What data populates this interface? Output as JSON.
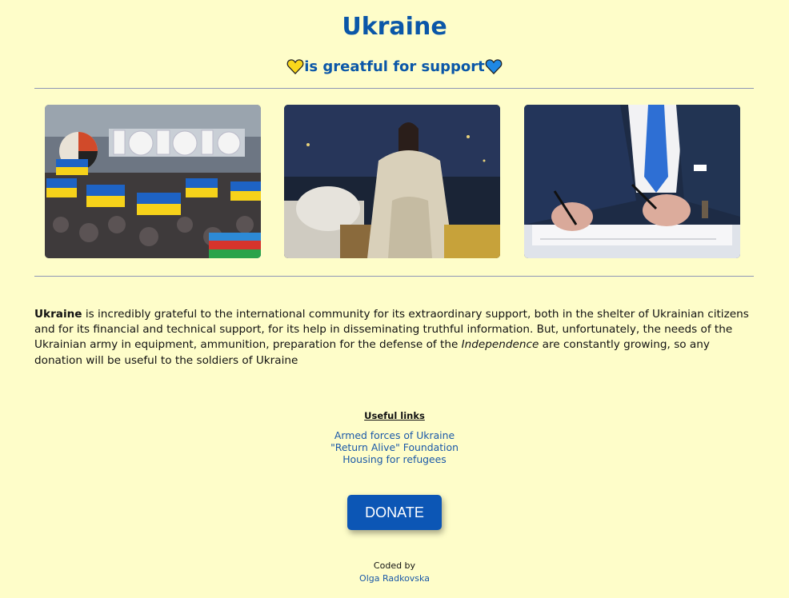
{
  "header": {
    "title": "Ukraine",
    "subtitle": "is greatful for support"
  },
  "intro": {
    "bold_lead": "Ukraine",
    "text_part1": " is incredibly grateful to the international community for its extraordinary support, both in the shelter of Ukrainian citizens and for its financial and technical support, for its help in disseminating truthful information. But, unfortunately, the needs of the Ukrainian army in equipment, ammunition, preparation for the defense of the ",
    "italic_word": "Independence",
    "text_part2": " are constantly growing, so any donation will be useful to the soldiers of Ukraine"
  },
  "links": {
    "title": "Useful links",
    "items": [
      "Armed forces of Ukraine",
      "\"Return Alive\" Foundation",
      "Housing for refugees"
    ]
  },
  "donate_label": "DONATE",
  "footer": {
    "coded_by": "Coded by",
    "author": "Olga Radkovska"
  },
  "colors": {
    "background": "#fefdc9",
    "accent_blue": "#0b57a8",
    "flag_yellow": "#f9d71c",
    "button_blue": "#0c56b5"
  },
  "icons": [
    "yellow-heart-icon",
    "blue-heart-icon"
  ]
}
